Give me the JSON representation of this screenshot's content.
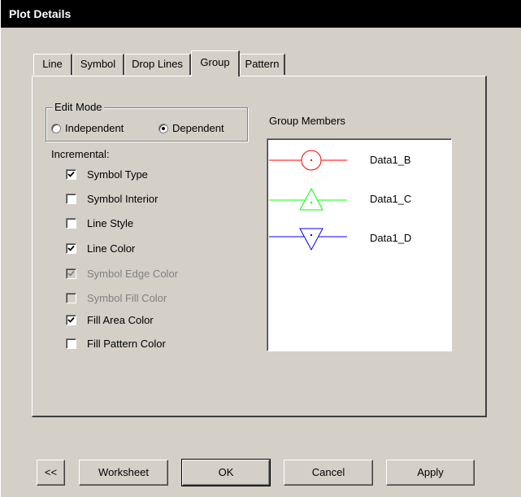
{
  "window": {
    "title": "Plot Details"
  },
  "tabs": [
    {
      "label": "Line",
      "active": false
    },
    {
      "label": "Symbol",
      "active": false
    },
    {
      "label": "Drop Lines",
      "active": false
    },
    {
      "label": "Group",
      "active": true
    },
    {
      "label": "Pattern",
      "active": false
    }
  ],
  "edit_mode": {
    "label": "Edit Mode",
    "options": [
      {
        "label": "Independent",
        "selected": false
      },
      {
        "label": "Dependent",
        "selected": true
      }
    ]
  },
  "incremental": {
    "label": "Incremental:",
    "items": [
      {
        "label": "Symbol Type",
        "checked": true,
        "enabled": true
      },
      {
        "label": "Symbol Interior",
        "checked": false,
        "enabled": true
      },
      {
        "label": "Line Style",
        "checked": false,
        "enabled": true
      },
      {
        "label": "Line Color",
        "checked": true,
        "enabled": true
      },
      {
        "label": "Symbol Edge Color",
        "checked": true,
        "enabled": false
      },
      {
        "label": "Symbol Fill Color",
        "checked": false,
        "enabled": false
      },
      {
        "label": "Fill Area Color",
        "checked": true,
        "enabled": true
      },
      {
        "label": "Fill Pattern Color",
        "checked": false,
        "enabled": true
      }
    ]
  },
  "group_members": {
    "label": "Group Members",
    "items": [
      {
        "name": "Data1_B",
        "color": "#ff0000",
        "symbol": "circle"
      },
      {
        "name": "Data1_C",
        "color": "#00ff00",
        "symbol": "triangle-up"
      },
      {
        "name": "Data1_D",
        "color": "#0000ff",
        "symbol": "triangle-down"
      }
    ]
  },
  "buttons": {
    "back": "<<",
    "worksheet": "Worksheet",
    "ok": "OK",
    "cancel": "Cancel",
    "apply": "Apply"
  }
}
